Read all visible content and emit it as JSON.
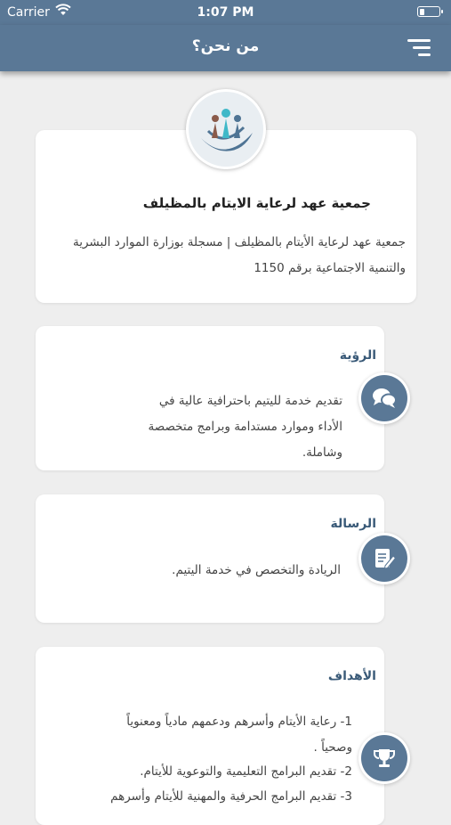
{
  "status_bar": {
    "carrier": "Carrier",
    "time": "1:07 PM"
  },
  "header": {
    "title": "من نحن؟"
  },
  "about": {
    "title": "جمعية عهد لرعاية الايتام بالمظيلف",
    "description": "جمعية عهد لرعاية الأيتام بالمظيلف | مسجلة بوزارة الموارد البشرية والتنمية الاجتماعية برقم 1150"
  },
  "vision": {
    "title": "الرؤية",
    "text": "تقديم خدمة لليتيم باحترافية عالية في الأداء وموارد مستدامة وبرامج متخصصة وشاملة.",
    "icon": "chat-bubbles-icon"
  },
  "mission": {
    "title": "الرسالة",
    "text": "الريادة والتخصص في خدمة اليتيم.",
    "icon": "document-edit-icon"
  },
  "goals": {
    "title": "الأهداف",
    "items": [
      "1- رعاية الأيتام وأسرهم ودعمهم مادياً ومعنوياً وصحياً .",
      "2- تقديم البرامج التعليمية والتوعوية للأيتام.",
      "3- تقديم البرامج الحرفية والمهنية للأيتام وأسرهم"
    ],
    "icon": "trophy-icon"
  },
  "colors": {
    "primary": "#5a7896",
    "background": "#eeeeee",
    "card": "#ffffff",
    "heading": "#3a5a78"
  }
}
